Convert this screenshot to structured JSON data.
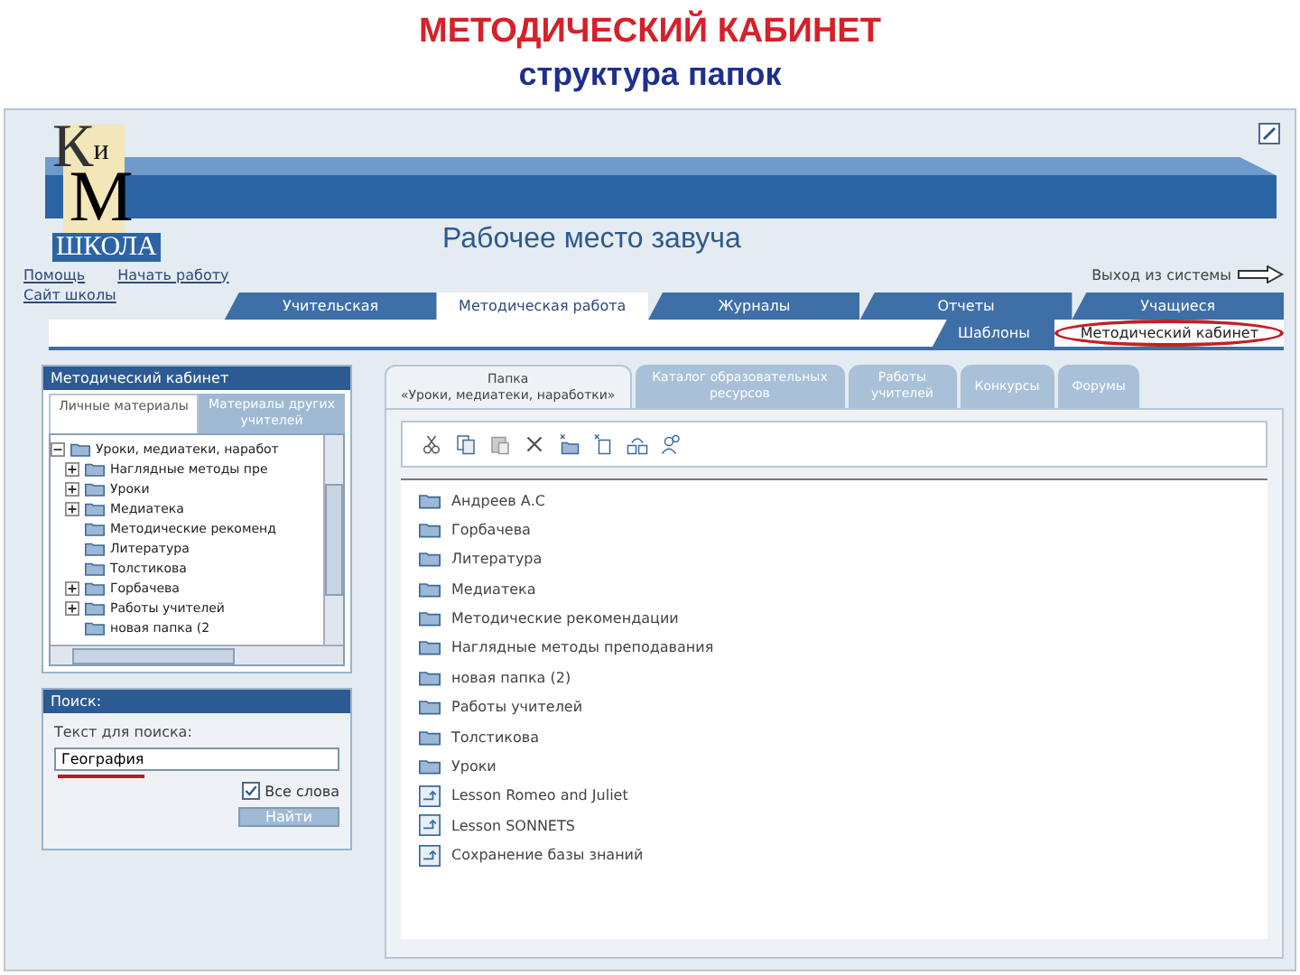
{
  "slide": {
    "title": "МЕТОДИЧЕСКИЙ КАБИНЕТ",
    "subtitle": "структура папок"
  },
  "header": {
    "logo_letters": [
      "К",
      "и",
      "М"
    ],
    "logo_caption": "ШКОЛА",
    "title": "Рабочее место завуча",
    "links": [
      "Помощь",
      "Начать работу"
    ],
    "site_link": "Сайт школы",
    "logout": "Выход из системы"
  },
  "main_tabs": [
    {
      "label": "Учительская",
      "selected": false
    },
    {
      "label": "Методическая работа",
      "selected": true
    },
    {
      "label": "Журналы",
      "selected": false
    },
    {
      "label": "Отчеты",
      "selected": false
    },
    {
      "label": "Учащиеся",
      "selected": false
    }
  ],
  "sub_tabs": [
    {
      "label": "Шаблоны",
      "selected": false,
      "circled": false
    },
    {
      "label": "Методический кабинет",
      "selected": true,
      "circled": true
    }
  ],
  "left_panel": {
    "title": "Методический кабинет",
    "tabs": [
      {
        "label": "Личные материалы",
        "selected": true
      },
      {
        "label": "Материалы других учителей",
        "selected": false
      }
    ],
    "tree": [
      {
        "label": "Уроки, медиатеки, наработ",
        "expanded": true,
        "children": [
          {
            "label": "Наглядные методы пре",
            "expandable": true
          },
          {
            "label": "Уроки",
            "expandable": true
          },
          {
            "label": "Медиатека",
            "expandable": true
          },
          {
            "label": "Методические рекоменд",
            "expandable": false
          },
          {
            "label": "Литература",
            "expandable": false
          },
          {
            "label": "Толстикова",
            "expandable": false
          },
          {
            "label": "Горбачева",
            "expandable": true
          },
          {
            "label": "Работы учителей",
            "expandable": true
          },
          {
            "label": "новая папка (2",
            "expandable": false
          }
        ]
      }
    ]
  },
  "search_panel": {
    "title": "Поиск:",
    "label": "Текст для поиска:",
    "value": "География",
    "underlined": true,
    "all_words": {
      "label": "Все слова",
      "checked": true
    },
    "button": "Найти"
  },
  "content_tabs": [
    {
      "label": "Папка",
      "sublabel": "«Уроки, медиатеки, наработки»",
      "selected": true
    },
    {
      "label": "Каталог образовательных ресурсов",
      "selected": false
    },
    {
      "label": "Работы учителей",
      "selected": false
    },
    {
      "label": "Конкурсы",
      "selected": false
    },
    {
      "label": "Форумы",
      "selected": false
    }
  ],
  "files": [
    {
      "name": "Андреев А.С",
      "kind": "folder"
    },
    {
      "name": "Горбачева",
      "kind": "folder"
    },
    {
      "name": "Литература",
      "kind": "folder"
    },
    {
      "name": "Медиатека",
      "kind": "folder"
    },
    {
      "name": "Методические рекомендации",
      "kind": "folder"
    },
    {
      "name": "Наглядные методы преподавания",
      "kind": "folder"
    },
    {
      "name": "новая папка (2)",
      "kind": "folder"
    },
    {
      "name": "Работы учителей",
      "kind": "folder"
    },
    {
      "name": "Толстикова",
      "kind": "folder"
    },
    {
      "name": "Уроки",
      "kind": "folder"
    },
    {
      "name": "Lesson Romeo and Juliet",
      "kind": "file"
    },
    {
      "name": "Lesson SONNETS",
      "kind": "file"
    },
    {
      "name": "Сохранение базы знаний",
      "kind": "file"
    }
  ]
}
